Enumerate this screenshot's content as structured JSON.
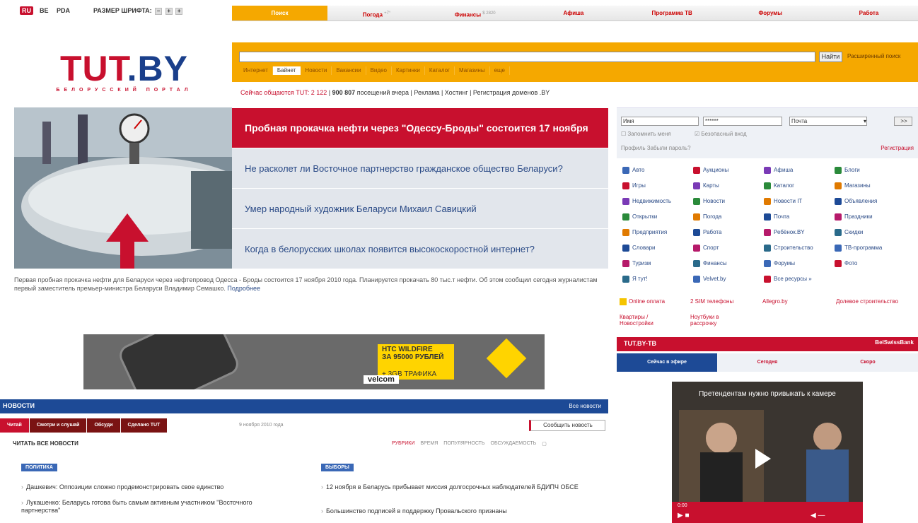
{
  "topbar": {
    "lang_ru": "RU",
    "lang_be": "BE",
    "pda": "PDA",
    "font_size_label": "РАЗМЕР ШРИФТА:",
    "font_btns": [
      "–",
      "+",
      "+"
    ]
  },
  "tabs": [
    {
      "label": "Поиск",
      "sup": ""
    },
    {
      "label": "Погода",
      "sup": "+7°"
    },
    {
      "label": "Финансы",
      "sup": "$ 2820"
    },
    {
      "label": "Афиша",
      "sup": ""
    },
    {
      "label": "Программа ТВ",
      "sup": ""
    },
    {
      "label": "Форумы",
      "sup": ""
    },
    {
      "label": "Работа",
      "sup": ""
    }
  ],
  "logo": {
    "tut": "TUT",
    "by": ".BY",
    "sub": "БЕЛОРУССКИЙ ПОРТАЛ"
  },
  "search": {
    "find": "Найти",
    "advanced": "Расширенный поиск",
    "tabs": [
      "Интернет",
      "Байнет",
      "Новости",
      "Вакансии",
      "Видео",
      "Картинки",
      "Каталог",
      "Магазины",
      "еще"
    ]
  },
  "online": {
    "prefix": "Сейчас общаются TUT:",
    "count": "2 122",
    "visits": "900 807",
    "rest": "посещений вчера | Реклама | Хостинг | Регистрация доменов .BY"
  },
  "hero": {
    "items": [
      "Пробная прокачка нефти через \"Одессу-Броды\" состоится 17 ноября",
      "Не расколет ли Восточное партнерство гражданское общество Беларуси?",
      "Умер народный художник Беларуси Михаил Савицкий",
      "Когда в белорусских школах появится высокоскоростной интернет?"
    ],
    "caption": "Первая пробная прокачка нефти для Беларуси через нефтепровод Одесса - Броды состоится 17 ноября 2010 года. Планируется прокачать 80 тыс.т нефти. Об этом сообщил сегодня журналистам первый заместитель премьер-министра Беларуси Владимир Семашко.",
    "more": "Подробнее"
  },
  "login": {
    "user": "Имя",
    "pass": "******",
    "service": "Почта",
    "go": ">>",
    "remember": "Запомнить меня",
    "secure": "Безопасный вход",
    "links": "Профиль Забыли пароль?",
    "register": "Регистрация"
  },
  "services": [
    [
      "Авто",
      "Аукционы",
      "Афиша",
      "Блоги"
    ],
    [
      "Игры",
      "Карты",
      "Каталог",
      "Магазины"
    ],
    [
      "Недвижимость",
      "Новости",
      "Новости IT",
      "Объявления"
    ],
    [
      "Открытки",
      "Погода",
      "Почта",
      "Праздники"
    ],
    [
      "Предприятия",
      "Работа",
      "Ребёнок.BY",
      "Скидки"
    ],
    [
      "Словари",
      "Спорт",
      "Строительство",
      "ТВ-программа"
    ],
    [
      "Туризм",
      "Финансы",
      "Форумы",
      "Фото"
    ],
    [
      "Я тут!",
      "Velvet.by",
      "Все ресурсы »",
      ""
    ]
  ],
  "promo": {
    "a": "Online оплата",
    "b": "2 SIM телефоны",
    "c": "Allegro.by",
    "d": "Долевое строительство",
    "e": "Квартиры / Новостройки",
    "f": "Ноутбуки в рассрочку"
  },
  "ad": {
    "line1": "HTC WILDFIRE",
    "line2": "ЗА 95000 РУБЛЕЙ",
    "line3": "+ 3GB ТРАФИКА",
    "brand": "velcom"
  },
  "news": {
    "title": "НОВОСТИ",
    "all": "Все новости",
    "tabs": [
      "Читай",
      "Смотри и слушай",
      "Обсуди",
      "Сделано TUT"
    ],
    "date": "9 ноября 2010 года",
    "report": "Сообщить новость",
    "read_all": "ЧИТАТЬ ВСЕ НОВОСТИ",
    "sort": [
      "РУБРИКИ",
      "ВРЕМЯ",
      "ПОПУЛЯРНОСТЬ",
      "ОБСУЖДАЕМОСТЬ"
    ],
    "cat1": "ПОЛИТИКА",
    "cat2": "ВЫБОРЫ",
    "left": [
      "Дашкевич: Оппозиции сложно продемонстрировать свое единство",
      "Лукашенко: Беларусь готова быть самым активным участником \"Восточного партнерства\""
    ],
    "right": [
      "12 ноября в Беларусь прибывает миссия долгосрочных наблюдателей БДИПЧ ОБСЕ",
      "Большинство подписей в поддержку Провальского признаны"
    ]
  },
  "tv": {
    "title": "TUT.BY-TB",
    "partner": "BelSwissBank",
    "tabs": [
      "Сейчас в эфире",
      "Сегодня",
      "Скоро"
    ],
    "video_title": "Претендентам нужно привыкать к камере",
    "time": "0:00"
  },
  "colors": {
    "red": "#c8102e",
    "blue": "#1d4a96",
    "orange": "#f5a800"
  }
}
